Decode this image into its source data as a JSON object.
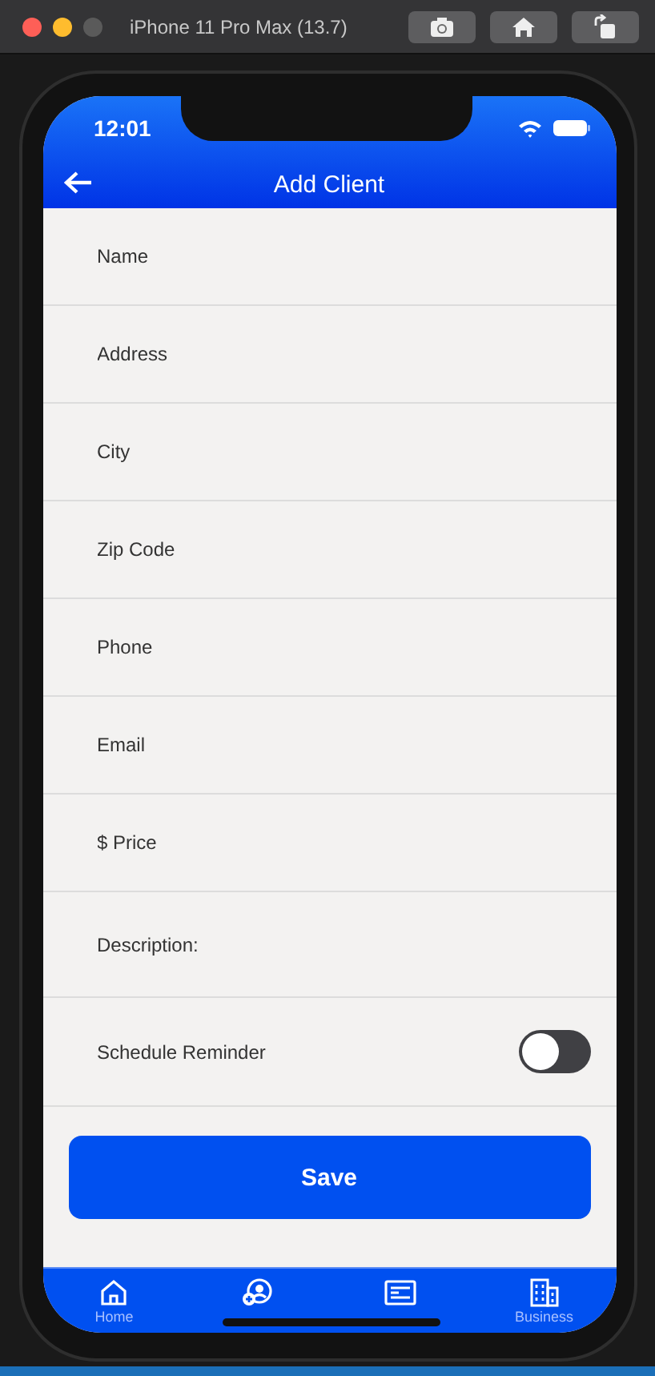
{
  "window": {
    "title": "iPhone 11 Pro Max (13.7)"
  },
  "status_bar": {
    "time": "12:01"
  },
  "header": {
    "title": "Add Client"
  },
  "fields": [
    {
      "placeholder": "Name"
    },
    {
      "placeholder": "Address"
    },
    {
      "placeholder": "City"
    },
    {
      "placeholder": "Zip Code"
    },
    {
      "placeholder": "Phone"
    },
    {
      "placeholder": "Email"
    },
    {
      "placeholder": "$ Price"
    },
    {
      "placeholder": "Description:",
      "kind": "multiline"
    }
  ],
  "reminder": {
    "label": "Schedule Reminder",
    "on": false
  },
  "save_button": "Save",
  "tabs": [
    {
      "kind": "home",
      "label": "Home"
    },
    {
      "kind": "add-user"
    },
    {
      "kind": "list"
    },
    {
      "kind": "building",
      "label": "Business"
    }
  ]
}
